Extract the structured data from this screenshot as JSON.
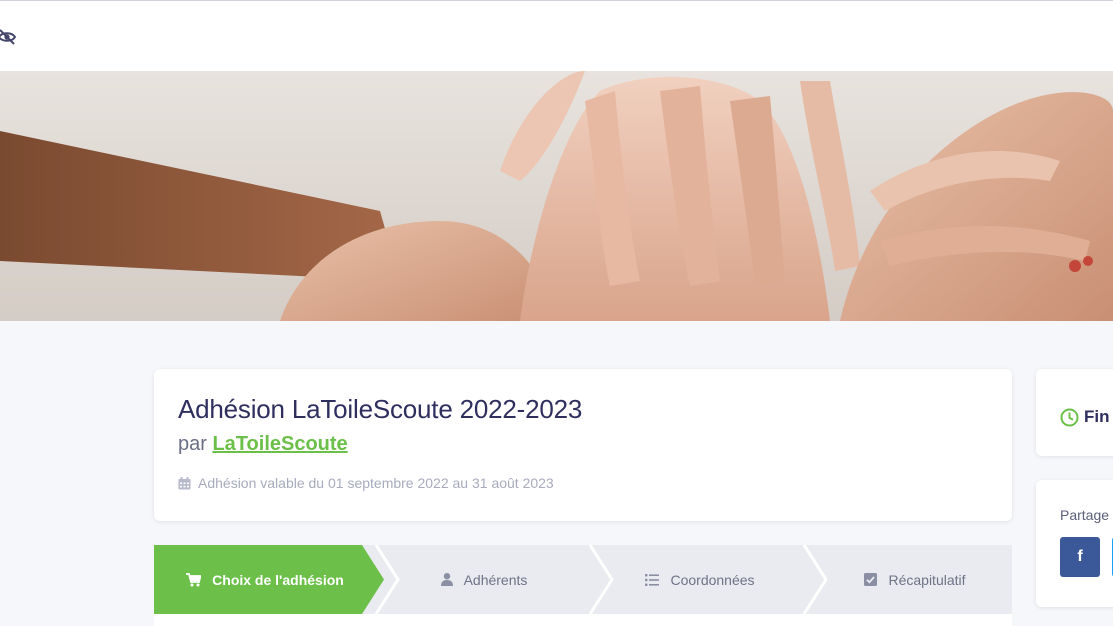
{
  "header": {
    "visibility_icon": "eye-slash-icon"
  },
  "banner": {
    "image": "hands-stacked-together-photo"
  },
  "campaign": {
    "title": "Adhésion LaToileScoute 2022-2023",
    "by_prefix": "par",
    "organization": "LaToileScoute",
    "validity": "Adhésion valable du 01 septembre 2022 au 31 août 2023",
    "validity_icon": "calendar-icon"
  },
  "steps": [
    {
      "label": "Choix de l'adhésion",
      "icon": "cart-icon",
      "active": true
    },
    {
      "label": "Adhérents",
      "icon": "user-icon",
      "active": false
    },
    {
      "label": "Coordonnées",
      "icon": "list-icon",
      "active": false
    },
    {
      "label": "Récapitulatif",
      "icon": "check-square-icon",
      "active": false
    }
  ],
  "sidebar": {
    "end_label": "Fin",
    "end_icon": "clock-icon",
    "share_label": "Partage",
    "share_facebook": "f"
  },
  "colors": {
    "primary_text": "#2e2f5e",
    "accent_green": "#6cc04a",
    "step_inactive": "#e9ebf0",
    "facebook": "#3b5998",
    "page_bg": "#f6f7fb"
  }
}
